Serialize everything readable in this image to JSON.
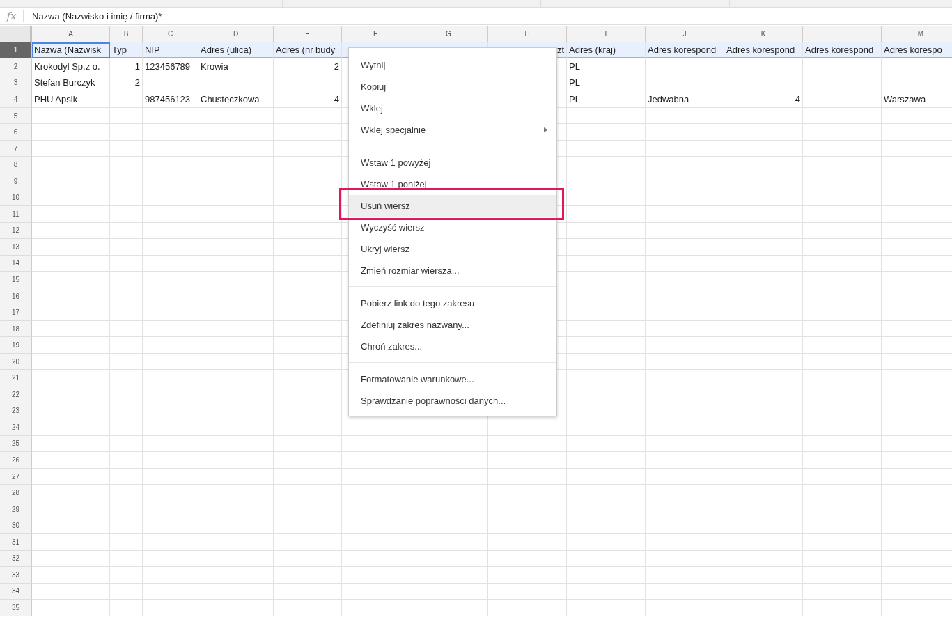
{
  "formula_bar": {
    "label": "fx",
    "value": "Nazwa (Nazwisko i imię / firma)*"
  },
  "columns": [
    "A",
    "B",
    "C",
    "D",
    "E",
    "F",
    "G",
    "H",
    "I",
    "J",
    "K",
    "L",
    "M"
  ],
  "rows": [
    {
      "number": "1",
      "selected": true,
      "cells": [
        "Nazwa (Nazwisk",
        "Typ",
        "NIP",
        "Adres (ulica)",
        "Adres (nr budy",
        null,
        null,
        "zt",
        "Adres (kraj)",
        "Adres korespond",
        "Adres korespond",
        "Adres korespond",
        "Adres korespo"
      ]
    },
    {
      "number": "2",
      "selected": false,
      "cells": [
        "Krokodyl Sp.z o.",
        "1",
        "123456789",
        "Krowia",
        "2",
        null,
        null,
        null,
        "PL",
        null,
        null,
        null,
        null
      ]
    },
    {
      "number": "3",
      "selected": false,
      "cells": [
        "Stefan Burczyk",
        "2",
        null,
        null,
        null,
        null,
        null,
        null,
        "PL",
        null,
        null,
        null,
        null
      ]
    },
    {
      "number": "4",
      "selected": false,
      "cells": [
        "PHU Apsik",
        null,
        "987456123",
        "Chusteczkowa",
        "4",
        null,
        null,
        null,
        "PL",
        "Jedwabna",
        "4",
        null,
        "Warszawa"
      ]
    },
    {
      "number": "5",
      "selected": false
    },
    {
      "number": "6",
      "selected": false
    },
    {
      "number": "7",
      "selected": false
    },
    {
      "number": "8",
      "selected": false
    },
    {
      "number": "9",
      "selected": false
    },
    {
      "number": "10",
      "selected": false
    },
    {
      "number": "11",
      "selected": false
    },
    {
      "number": "12",
      "selected": false
    },
    {
      "number": "13",
      "selected": false
    },
    {
      "number": "14",
      "selected": false
    },
    {
      "number": "15",
      "selected": false
    },
    {
      "number": "16",
      "selected": false
    },
    {
      "number": "17",
      "selected": false
    },
    {
      "number": "18",
      "selected": false
    },
    {
      "number": "19",
      "selected": false
    },
    {
      "number": "20",
      "selected": false
    },
    {
      "number": "21",
      "selected": false
    },
    {
      "number": "22",
      "selected": false
    },
    {
      "number": "23",
      "selected": false
    },
    {
      "number": "24",
      "selected": false
    },
    {
      "number": "25",
      "selected": false
    },
    {
      "number": "26",
      "selected": false
    },
    {
      "number": "27",
      "selected": false
    },
    {
      "number": "28",
      "selected": false
    },
    {
      "number": "29",
      "selected": false
    },
    {
      "number": "30",
      "selected": false
    },
    {
      "number": "31",
      "selected": false
    },
    {
      "number": "32",
      "selected": false
    },
    {
      "number": "33",
      "selected": false
    },
    {
      "number": "34",
      "selected": false
    },
    {
      "number": "35",
      "selected": false
    }
  ],
  "context_menu": {
    "groups": [
      {
        "items": [
          {
            "label": "Wytnij",
            "selected": false,
            "submenu": false
          },
          {
            "label": "Kopiuj",
            "selected": false,
            "submenu": false
          },
          {
            "label": "Wklej",
            "selected": false,
            "submenu": false
          },
          {
            "label": "Wklej specjalnie",
            "selected": false,
            "submenu": true
          }
        ]
      },
      {
        "items": [
          {
            "label": "Wstaw 1 powyżej",
            "selected": false,
            "submenu": false
          },
          {
            "label": "Wstaw 1 poniżej",
            "selected": false,
            "submenu": false
          },
          {
            "label": "Usuń wiersz",
            "selected": true,
            "submenu": false
          },
          {
            "label": "Wyczyść wiersz",
            "selected": false,
            "submenu": false
          },
          {
            "label": "Ukryj wiersz",
            "selected": false,
            "submenu": false
          },
          {
            "label": "Zmień rozmiar wiersza...",
            "selected": false,
            "submenu": false
          }
        ]
      },
      {
        "items": [
          {
            "label": "Pobierz link do tego zakresu",
            "selected": false,
            "submenu": false
          },
          {
            "label": "Zdefiniuj zakres nazwany...",
            "selected": false,
            "submenu": false
          },
          {
            "label": "Chroń zakres...",
            "selected": false,
            "submenu": false
          }
        ]
      },
      {
        "items": [
          {
            "label": "Formatowanie warunkowe...",
            "selected": false,
            "submenu": false
          },
          {
            "label": "Sprawdzanie poprawności danych...",
            "selected": false,
            "submenu": false
          }
        ]
      }
    ]
  }
}
